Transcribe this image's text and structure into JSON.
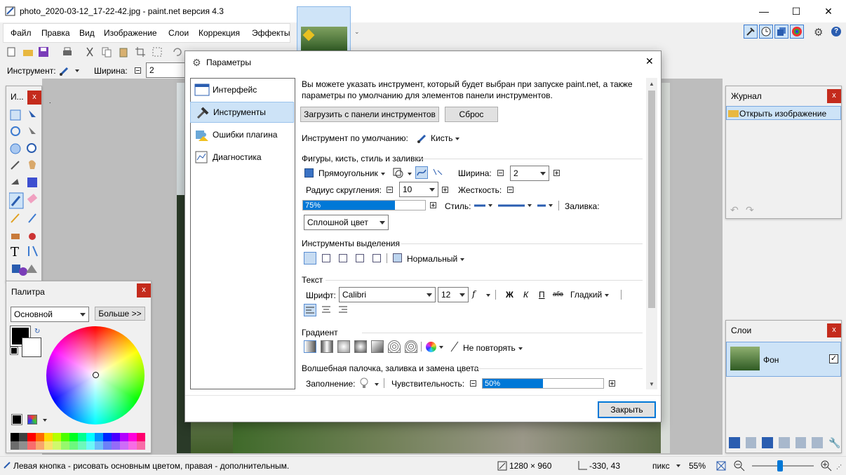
{
  "window": {
    "title": "photo_2020-03-12_17-22-42.jpg - paint.net версия 4.3",
    "minimize": "—",
    "maximize": "☐",
    "close": "✕"
  },
  "menu": [
    "Файл",
    "Правка",
    "Вид",
    "Изображение",
    "Слои",
    "Коррекция",
    "Эффекты"
  ],
  "toolbar": {
    "tool_label": "Инструмент:",
    "width_label": "Ширина:",
    "width_value": "2"
  },
  "tools_panel": {
    "title": "И..."
  },
  "palette": {
    "title": "Палитра",
    "mode": "Основной",
    "more_button": "Больше >>",
    "colors": [
      "#000000",
      "#404040",
      "#ff0000",
      "#ff6a00",
      "#ffd800",
      "#b6ff00",
      "#4cff00",
      "#00ff21",
      "#00ff90",
      "#00ffff",
      "#0094ff",
      "#0026ff",
      "#4800ff",
      "#b200ff",
      "#ff00dc",
      "#ff006e"
    ]
  },
  "history": {
    "title": "Журнал",
    "items": [
      "Открыть изображение"
    ]
  },
  "layers": {
    "title": "Слои",
    "items": [
      "Фон"
    ]
  },
  "dialog": {
    "title": "Параметры",
    "close_icon": "✕",
    "nav": [
      "Интерфейс",
      "Инструменты",
      "Ошибки плагина",
      "Диагностика"
    ],
    "description": "Вы можете указать инструмент, который будет выбран при запуске paint.net, а также параметры по умолчанию для элементов панели инструментов.",
    "load_button": "Загрузить с панели инструментов",
    "reset_button": "Сброс",
    "default_tool_label": "Инструмент по умолчанию:",
    "default_tool_value": "Кисть",
    "shapes_section": "Фигуры, кисть, стиль и заливки",
    "shape_value": "Прямоугольник",
    "width_label": "Ширина:",
    "width_value": "2",
    "radius_label": "Радиус скругления:",
    "radius_value": "10",
    "hardness_label": "Жесткость:",
    "hardness_value": "75%",
    "hardness_fraction": 0.75,
    "style_label": "Стиль:",
    "fill_label": "Заливка:",
    "fill_value": "Сплошной цвет",
    "selection_section": "Инструменты выделения",
    "selection_mode": "Нормальный",
    "text_section": "Текст",
    "font_label": "Шрифт:",
    "font_value": "Calibri",
    "font_size": "12",
    "bold": "Ж",
    "italic": "К",
    "underline": "П",
    "strike": "абв",
    "smoothing": "Гладкий",
    "gradient_section": "Градиент",
    "gradient_repeat": "Не повторять",
    "magic_section": "Волшебная палочка, заливка и замена цвета",
    "flood_label": "Заполнение:",
    "tolerance_label": "Чувствительность:",
    "tolerance_value": "50%",
    "tolerance_fraction": 0.5,
    "close_button": "Закрыть"
  },
  "status": {
    "hint": "Левая кнопка - рисовать основным цветом, правая - дополнительным.",
    "image_size": "1280 × 960",
    "cursor": "-330, 43",
    "units": "пикс",
    "zoom": "55%"
  }
}
